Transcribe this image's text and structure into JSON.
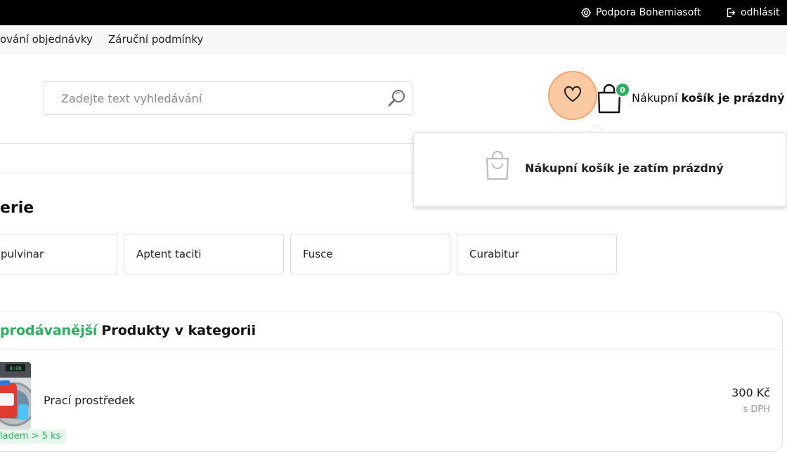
{
  "topbar": {
    "support_label": "Podpora Bohemiasoft",
    "logout_label": "odhlásit"
  },
  "nav": {
    "items": [
      "ování objednávky",
      "Záruční podmínky"
    ]
  },
  "search": {
    "placeholder": "Zadejte text vyhledávání"
  },
  "cart": {
    "count": "0",
    "label_regular": "Nákupní",
    "label_bold": "košík je prázdný",
    "dropdown_message": "Nákupní košík je zatím prázdný"
  },
  "categories": {
    "title": "erie",
    "items": [
      "pulvinar",
      "Aptent taciti",
      "Fusce",
      "Curabitur"
    ]
  },
  "bestsellers": {
    "title_green": "prodávanější",
    "title_black": "Produkty v kategorii",
    "products": [
      {
        "name": "Prací prostředek",
        "price": "300 Kč",
        "vat": "s DPH",
        "stock": "ladem > 5 ks",
        "image_digits": "8:00"
      }
    ]
  },
  "colors": {
    "accent_green": "#2ab15c",
    "wishlist_highlight": "#fbc9a2",
    "topbar": "#000000"
  },
  "icons": {
    "support": "gear-icon",
    "logout": "logout-icon",
    "search": "search-icon",
    "wishlist": "heart-icon",
    "cart": "shopping-bag-icon"
  }
}
